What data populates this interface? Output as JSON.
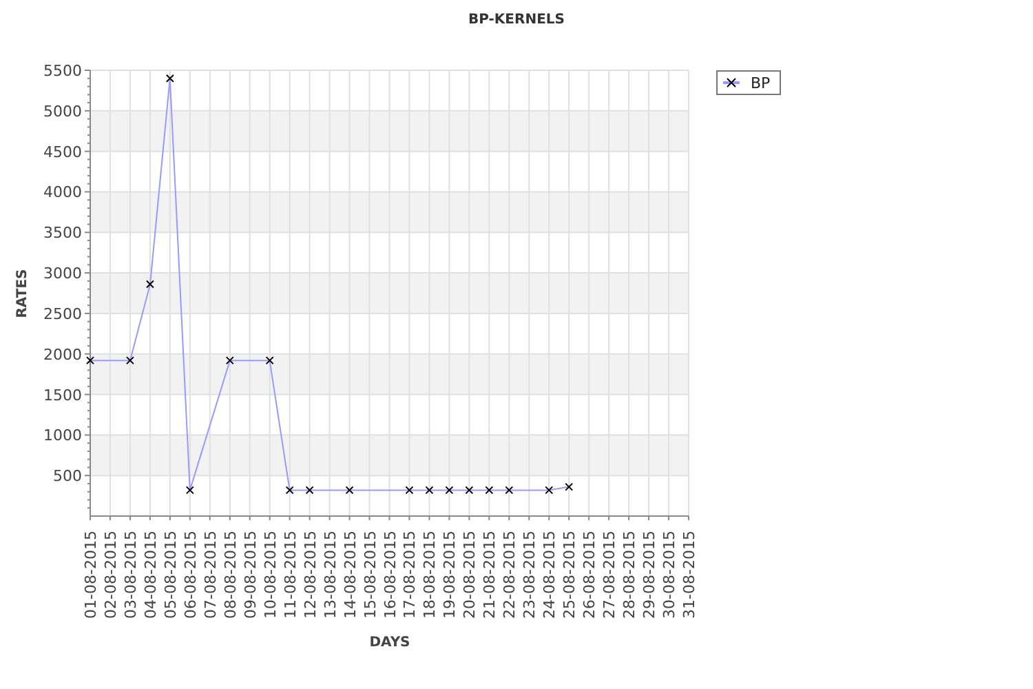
{
  "chart_data": {
    "type": "line",
    "title": "BP-KERNELS",
    "xlabel": "DAYS",
    "ylabel": "RATES",
    "categories": [
      "01-08-2015",
      "02-08-2015",
      "03-08-2015",
      "04-08-2015",
      "05-08-2015",
      "06-08-2015",
      "07-08-2015",
      "08-08-2015",
      "09-08-2015",
      "10-08-2015",
      "11-08-2015",
      "12-08-2015",
      "13-08-2015",
      "14-08-2015",
      "15-08-2015",
      "16-08-2015",
      "17-08-2015",
      "18-08-2015",
      "19-08-2015",
      "20-08-2015",
      "21-08-2015",
      "22-08-2015",
      "23-08-2015",
      "24-08-2015",
      "25-08-2015",
      "26-08-2015",
      "27-08-2015",
      "28-08-2015",
      "29-08-2015",
      "30-08-2015",
      "31-08-2015"
    ],
    "grid": true,
    "series": [
      {
        "name": "BP",
        "color": "#9999ff",
        "marker": "x",
        "values": [
          1920,
          null,
          1920,
          2860,
          5400,
          320,
          null,
          1920,
          null,
          1920,
          320,
          320,
          null,
          320,
          null,
          null,
          320,
          320,
          320,
          320,
          320,
          320,
          null,
          320,
          360,
          null,
          null,
          null,
          null,
          null,
          null
        ]
      }
    ],
    "ylim": [
      0,
      5500
    ],
    "yticks": [
      500,
      1000,
      1500,
      2000,
      2500,
      3000,
      3500,
      4000,
      4500,
      5000,
      5500
    ]
  }
}
